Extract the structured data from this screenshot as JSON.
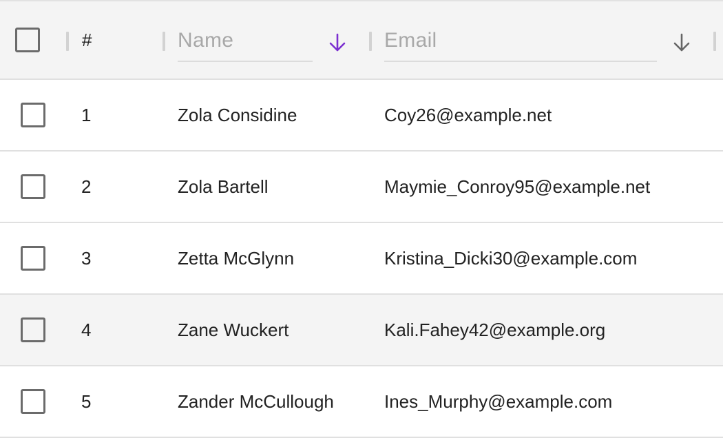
{
  "header": {
    "number_label": "#",
    "name_filter_placeholder": "Name",
    "email_filter_placeholder": "Email",
    "name_sort_icon": "arrow-down-icon",
    "email_sort_icon": "arrow-down-icon",
    "name_sort_color": "#7b2fd0",
    "email_sort_color": "#666666"
  },
  "rows": [
    {
      "num": "1",
      "name": "Zola Considine",
      "email": "Coy26@example.net"
    },
    {
      "num": "2",
      "name": "Zola Bartell",
      "email": "Maymie_Conroy95@example.net"
    },
    {
      "num": "3",
      "name": "Zetta McGlynn",
      "email": "Kristina_Dicki30@example.com"
    },
    {
      "num": "4",
      "name": "Zane Wuckert",
      "email": "Kali.Fahey42@example.org"
    },
    {
      "num": "5",
      "name": "Zander McCullough",
      "email": "Ines_Murphy@example.com"
    }
  ],
  "colors": {
    "header_bg": "#f4f4f4",
    "hover_row_bg": "#f4f4f4",
    "border": "#e0e0e0",
    "accent": "#7b2fd0"
  }
}
